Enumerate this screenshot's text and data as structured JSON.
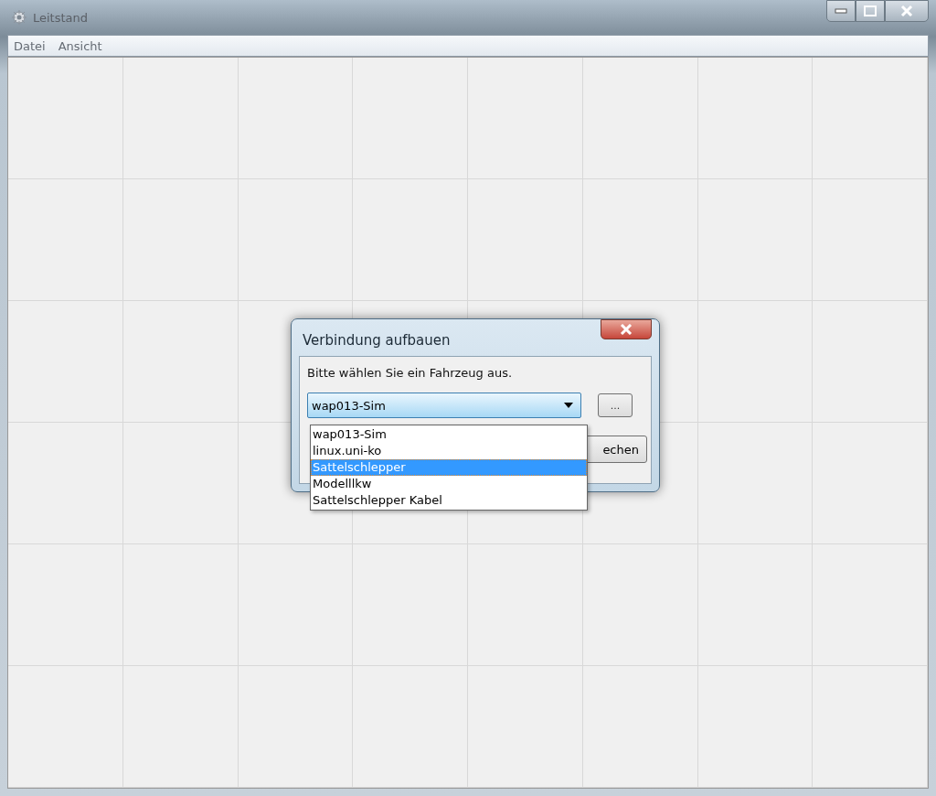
{
  "window": {
    "title": "Leitstand"
  },
  "menu": [
    {
      "label": "Datei"
    },
    {
      "label": "Ansicht"
    }
  ],
  "dialog": {
    "title": "Verbindung aufbauen",
    "prompt": "Bitte wählen Sie ein Fahrzeug aus.",
    "combo_value": "wap013-Sim",
    "browse_button": "...",
    "hidden_button": "echen",
    "options": [
      {
        "label": "wap013-Sim",
        "selected": false
      },
      {
        "label": "linux.uni-ko",
        "selected": false
      },
      {
        "label": "Sattelschlepper",
        "selected": true
      },
      {
        "label": "Modelllkw",
        "selected": false
      },
      {
        "label": "Sattelschlepper Kabel",
        "selected": false
      }
    ]
  }
}
